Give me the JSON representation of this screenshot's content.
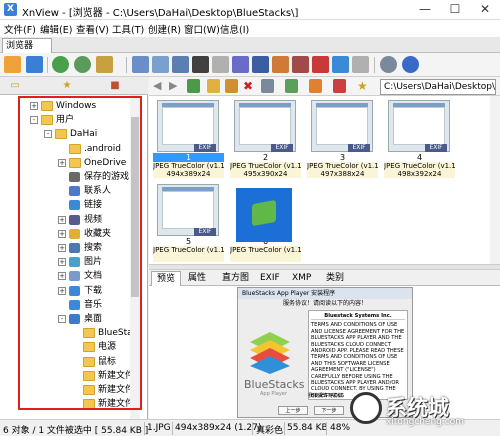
{
  "window": {
    "app_name": "XnView",
    "title": "XnView - [浏览器 - C:\\Users\\DaHai\\Desktop\\BlueStacks\\]",
    "controls": {
      "minimize": "—",
      "maximize": "☐",
      "close": "✕"
    }
  },
  "menu": {
    "items": [
      "文件(F)",
      "编辑(E)",
      "查看(V)",
      "工具(T)",
      "创建(R)",
      "窗口(W)",
      "信息(I)"
    ]
  },
  "tabs": {
    "browser": "浏览器"
  },
  "path": {
    "value": "C:\\Users\\DaHai\\Desktop\\"
  },
  "tree": {
    "nodes": [
      {
        "label": "Windows",
        "indent": 0,
        "expander": "+",
        "icon": "folder"
      },
      {
        "label": "用户",
        "indent": 0,
        "expander": "-",
        "icon": "folder"
      },
      {
        "label": "DaHai",
        "indent": 1,
        "expander": "-",
        "icon": "folder"
      },
      {
        "label": ".android",
        "indent": 2,
        "expander": "",
        "icon": "folder"
      },
      {
        "label": "OneDrive",
        "indent": 2,
        "expander": "+",
        "icon": "folder"
      },
      {
        "label": "保存的游戏",
        "indent": 2,
        "expander": "",
        "icon": "game"
      },
      {
        "label": "联系人",
        "indent": 2,
        "expander": "",
        "icon": "contacts"
      },
      {
        "label": "链接",
        "indent": 2,
        "expander": "",
        "icon": "links"
      },
      {
        "label": "视频",
        "indent": 2,
        "expander": "+",
        "icon": "video"
      },
      {
        "label": "收藏夹",
        "indent": 2,
        "expander": "+",
        "icon": "favorites"
      },
      {
        "label": "搜索",
        "indent": 2,
        "expander": "+",
        "icon": "search"
      },
      {
        "label": "图片",
        "indent": 2,
        "expander": "+",
        "icon": "pictures"
      },
      {
        "label": "文档",
        "indent": 2,
        "expander": "+",
        "icon": "documents"
      },
      {
        "label": "下载",
        "indent": 2,
        "expander": "+",
        "icon": "downloads"
      },
      {
        "label": "音乐",
        "indent": 2,
        "expander": "",
        "icon": "music"
      },
      {
        "label": "桌面",
        "indent": 2,
        "expander": "-",
        "icon": "desktop"
      },
      {
        "label": "BlueSta",
        "indent": 3,
        "expander": "",
        "icon": "folder"
      },
      {
        "label": "电源",
        "indent": 3,
        "expander": "",
        "icon": "folder"
      },
      {
        "label": "鼠标",
        "indent": 3,
        "expander": "",
        "icon": "folder"
      },
      {
        "label": "新建文件",
        "indent": 3,
        "expander": "",
        "icon": "folder"
      },
      {
        "label": "新建文件",
        "indent": 3,
        "expander": "",
        "icon": "folder"
      },
      {
        "label": "新建文件",
        "indent": 3,
        "expander": "",
        "icon": "folder"
      }
    ]
  },
  "thumbnails": {
    "items": [
      {
        "num": "1",
        "type": "JPEG TrueColor (v1.1)",
        "dims": "494x389x24",
        "selected": true
      },
      {
        "num": "2",
        "type": "JPEG TrueColor (v1.1)",
        "dims": "495x390x24",
        "selected": false
      },
      {
        "num": "3",
        "type": "JPEG TrueColor (v1.1)",
        "dims": "497x388x24",
        "selected": false
      },
      {
        "num": "4",
        "type": "JPEG TrueColor (v1.1)",
        "dims": "498x392x24",
        "selected": false
      },
      {
        "num": "5",
        "type": "JPEG TrueColor (v1.1)",
        "dims": "",
        "selected": false
      },
      {
        "num": "6",
        "type": "JPEG TrueColor (v1.1)",
        "dims": "",
        "selected": false
      }
    ],
    "badge": "EXIF"
  },
  "preview_tabs": [
    "预览",
    "属性",
    "直方图",
    "EXIF",
    "XMP",
    "类别"
  ],
  "preview": {
    "dialog_title": "BlueStacks App Player 安装程序",
    "dialog_heading": "服务协议！请阅读以下的内容！",
    "license_heading": "Bluestack Systems Inc.",
    "license_text": "Terms and conditions of use and license agreement for the Bluestacks App Player and the Bluestacks Cloud Connect Android app. Please read these terms and conditions of use and this software license agreement (\"license\") carefully before using the BlueStacks App Player and/or Cloud Connect. By using the BlueStacks",
    "logo_text": "BlueStacks",
    "logo_sub": "App Player",
    "checkbox": "我接受许可协议",
    "back_btn": "上一步",
    "next_btn": "下一步"
  },
  "status": {
    "objects": "6 对象 / 1 文件被选中  [ 55.84 KB ]",
    "file": "1.JPG",
    "info": "494x389x24 (1.27)",
    "color": "真彩色",
    "size": "55.84 KB",
    "zoom": "48%"
  },
  "watermark": {
    "text": "系统城",
    "url": "xitongcheng.com"
  }
}
